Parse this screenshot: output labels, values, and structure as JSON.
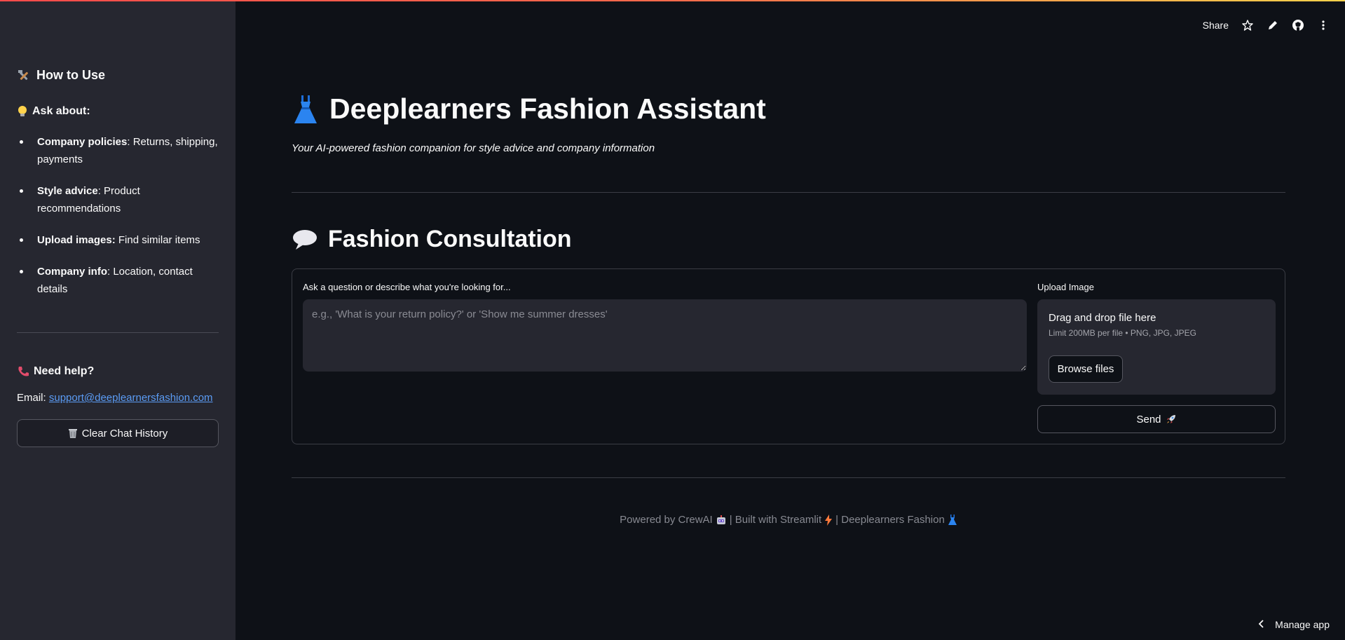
{
  "header": {
    "share_label": "Share"
  },
  "sidebar": {
    "how_to_use_title": "How to Use",
    "ask_about_title": "Ask about:",
    "items": [
      {
        "bold": "Company policies",
        "rest": ": Returns, shipping, payments"
      },
      {
        "bold": "Style advice",
        "rest": ": Product recommendations"
      },
      {
        "bold": "Upload images:",
        "rest": " Find similar items"
      },
      {
        "bold": "Company info",
        "rest": ": Location, contact details"
      }
    ],
    "need_help_title": "Need help?",
    "email_label": "Email:",
    "email_value": "support@deeplearnersfashion.com",
    "clear_button": "Clear Chat History"
  },
  "main": {
    "title": "Deeplearners Fashion Assistant",
    "subtitle": "Your AI-powered fashion companion for style advice and company information",
    "section_title": "Fashion Consultation",
    "question_label": "Ask a question or describe what you're looking for...",
    "question_placeholder": "e.g., 'What is your return policy?' or 'Show me summer dresses'",
    "question_value": "",
    "upload_label": "Upload Image",
    "dropzone_title": "Drag and drop file here",
    "dropzone_limit": "Limit 200MB per file • PNG, JPG, JPEG",
    "browse_button": "Browse files",
    "send_button": "Send"
  },
  "footer": {
    "part1": "Powered by CrewAI",
    "part2": "| Built with Streamlit",
    "part3": "| Deeplearners Fashion"
  },
  "manage_app_label": "Manage app",
  "icons": {
    "tools": "hammer-wrench-icon",
    "bulb": "lightbulb-icon",
    "phone": "telephone-icon",
    "trash": "wastebasket-icon",
    "dress": "dress-icon",
    "speech": "speech-balloon-icon",
    "rocket": "rocket-icon",
    "robot": "robot-icon",
    "lightning": "lightning-icon"
  },
  "colors": {
    "background": "#0e1117",
    "sidebar": "#262730",
    "link": "#5b9cf5",
    "accent_bar": "#ff4b4b"
  }
}
